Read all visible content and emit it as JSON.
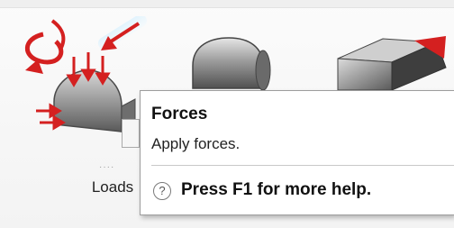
{
  "ribbon": {
    "tools": [
      {
        "label": "Loads",
        "dots": "····",
        "icon": "loads-icon"
      },
      {
        "icon": "cylinder-shape-icon"
      },
      {
        "icon": "box-shape-icon"
      }
    ]
  },
  "tooltip": {
    "title": "Forces",
    "description": "Apply forces.",
    "help_icon": "help-circle-icon",
    "help_glyph": "?",
    "help_text": "Press F1 for more help."
  },
  "colors": {
    "force_arrow": "#d42020",
    "metal": "#8a8a8a"
  }
}
